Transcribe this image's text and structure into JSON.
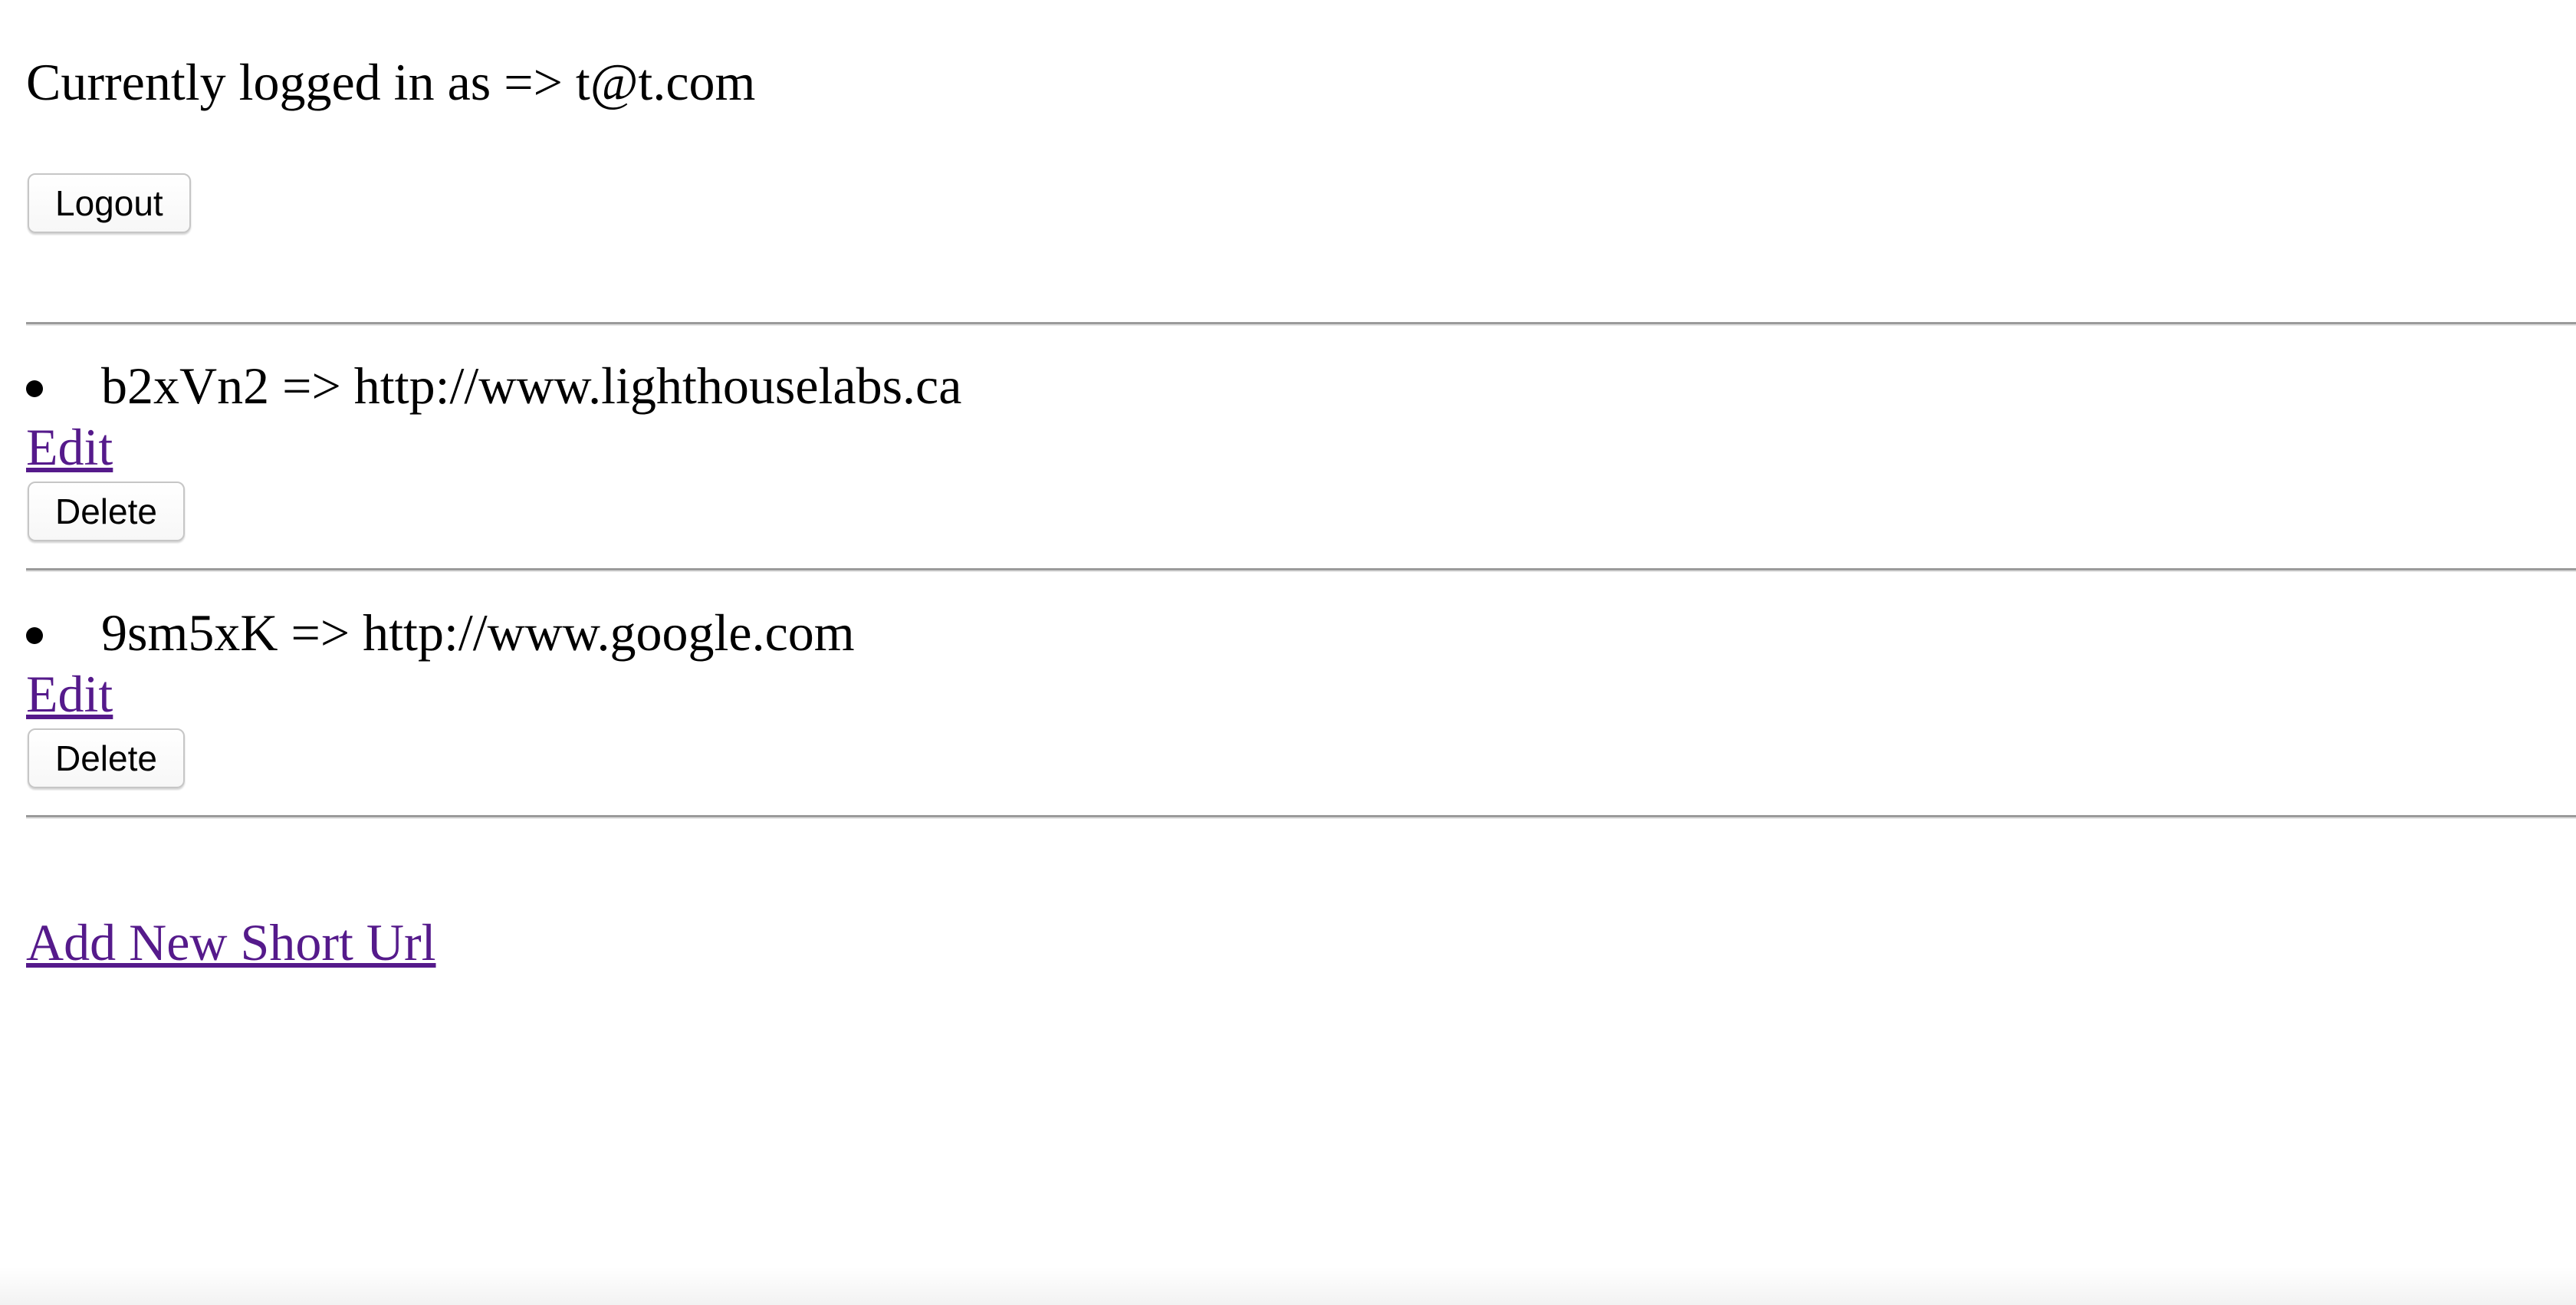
{
  "header": {
    "status_text": "Currently logged in as => t@t.com",
    "logout_label": "Logout"
  },
  "urls": [
    {
      "text": "b2xVn2 => http://www.lighthouselabs.ca",
      "edit_label": "Edit",
      "delete_label": "Delete"
    },
    {
      "text": "9sm5xK => http://www.google.com",
      "edit_label": "Edit",
      "delete_label": "Delete"
    }
  ],
  "footer": {
    "add_link_label": "Add New Short Url"
  },
  "colors": {
    "link_visited": "#551a8b",
    "text": "#000000",
    "rule": "#9a9a9a"
  }
}
